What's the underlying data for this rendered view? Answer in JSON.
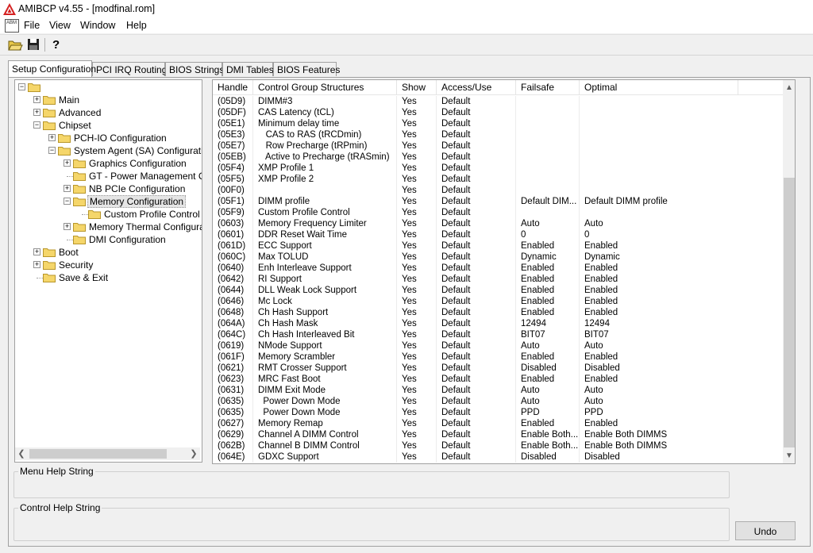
{
  "window": {
    "title": "AMIBCP v4.55 - [modfinal.rom]"
  },
  "menubar": {
    "app_icon_text": "ABM",
    "items": [
      "File",
      "View",
      "Window",
      "Help"
    ]
  },
  "toolbar": {
    "buttons": [
      "open-folder-icon",
      "save-icon",
      "help-icon"
    ]
  },
  "tabs": [
    "Setup Configuration",
    "PCI IRQ Routing",
    "BIOS Strings",
    "DMI Tables",
    "BIOS Features"
  ],
  "tree": {
    "items": [
      {
        "label": "",
        "level": 0,
        "expander": "minus"
      },
      {
        "label": "Main",
        "level": 1,
        "expander": "plus"
      },
      {
        "label": "Advanced",
        "level": 1,
        "expander": "plus"
      },
      {
        "label": "Chipset",
        "level": 1,
        "expander": "minus"
      },
      {
        "label": "PCH-IO Configuration",
        "level": 2,
        "expander": "plus"
      },
      {
        "label": "System Agent (SA) Configuration",
        "level": 2,
        "expander": "minus"
      },
      {
        "label": "Graphics Configuration",
        "level": 3,
        "expander": "plus"
      },
      {
        "label": "GT - Power Management Control",
        "level": 3,
        "expander": "none"
      },
      {
        "label": "NB PCIe Configuration",
        "level": 3,
        "expander": "plus"
      },
      {
        "label": "Memory Configuration",
        "level": 3,
        "expander": "minus",
        "selected": true
      },
      {
        "label": "Custom Profile Control",
        "level": 4,
        "expander": "none"
      },
      {
        "label": "Memory Thermal Configuration",
        "level": 3,
        "expander": "plus"
      },
      {
        "label": "DMI Configuration",
        "level": 3,
        "expander": "none"
      },
      {
        "label": "Boot",
        "level": 1,
        "expander": "plus"
      },
      {
        "label": "Security",
        "level": 1,
        "expander": "plus"
      },
      {
        "label": "Save & Exit",
        "level": 1,
        "expander": "none"
      }
    ]
  },
  "grid": {
    "columns": [
      "Handle",
      "Control Group Structures",
      "Show",
      "Access/Use",
      "Failsafe",
      "Optimal"
    ],
    "rows": [
      [
        "(05D9)",
        "DIMM#3",
        "Yes",
        "Default",
        "",
        ""
      ],
      [
        "(05DF)",
        "CAS Latency (tCL)",
        "Yes",
        "Default",
        "",
        ""
      ],
      [
        "(05E1)",
        "Minimum delay time",
        "Yes",
        "Default",
        "",
        ""
      ],
      [
        "(05E3)",
        "   CAS to RAS (tRCDmin)",
        "Yes",
        "Default",
        "",
        ""
      ],
      [
        "(05E7)",
        "   Row Precharge (tRPmin)",
        "Yes",
        "Default",
        "",
        ""
      ],
      [
        "(05EB)",
        "   Active to Precharge (tRASmin)",
        "Yes",
        "Default",
        "",
        ""
      ],
      [
        "(05F4)",
        "XMP Profile 1",
        "Yes",
        "Default",
        "",
        ""
      ],
      [
        "(05F5)",
        "XMP Profile 2",
        "Yes",
        "Default",
        "",
        ""
      ],
      [
        "(00F0)",
        "",
        "Yes",
        "Default",
        "",
        ""
      ],
      [
        "(05F1)",
        "DIMM profile",
        "Yes",
        "Default",
        "Default DIM...",
        "Default DIMM profile"
      ],
      [
        "(05F9)",
        "Custom Profile Control",
        "Yes",
        "Default",
        "",
        ""
      ],
      [
        "(0603)",
        "Memory Frequency Limiter",
        "Yes",
        "Default",
        "Auto",
        "Auto"
      ],
      [
        "(0601)",
        "DDR Reset Wait Time",
        "Yes",
        "Default",
        "0",
        "0"
      ],
      [
        "(061D)",
        "ECC Support",
        "Yes",
        "Default",
        "Enabled",
        "Enabled"
      ],
      [
        "(060C)",
        "Max TOLUD",
        "Yes",
        "Default",
        "Dynamic",
        "Dynamic"
      ],
      [
        "(0640)",
        "Enh Interleave Support",
        "Yes",
        "Default",
        "Enabled",
        "Enabled"
      ],
      [
        "(0642)",
        "RI Support",
        "Yes",
        "Default",
        "Enabled",
        "Enabled"
      ],
      [
        "(0644)",
        "DLL Weak Lock Support",
        "Yes",
        "Default",
        "Enabled",
        "Enabled"
      ],
      [
        "(0646)",
        "Mc Lock",
        "Yes",
        "Default",
        "Enabled",
        "Enabled"
      ],
      [
        "(0648)",
        "Ch Hash Support",
        "Yes",
        "Default",
        "Enabled",
        "Enabled"
      ],
      [
        "(064A)",
        "Ch Hash Mask",
        "Yes",
        "Default",
        "12494",
        "12494"
      ],
      [
        "(064C)",
        "Ch Hash Interleaved Bit",
        "Yes",
        "Default",
        "BIT07",
        "BIT07"
      ],
      [
        "(0619)",
        "NMode Support",
        "Yes",
        "Default",
        "Auto",
        "Auto"
      ],
      [
        "(061F)",
        "Memory Scrambler",
        "Yes",
        "Default",
        "Enabled",
        "Enabled"
      ],
      [
        "(0621)",
        "RMT Crosser Support",
        "Yes",
        "Default",
        "Disabled",
        "Disabled"
      ],
      [
        "(0623)",
        "MRC Fast Boot",
        "Yes",
        "Default",
        "Enabled",
        "Enabled"
      ],
      [
        "(0631)",
        "DIMM Exit Mode",
        "Yes",
        "Default",
        "Auto",
        "Auto"
      ],
      [
        "(0635)",
        "  Power Down Mode",
        "Yes",
        "Default",
        "Auto",
        "Auto"
      ],
      [
        "(0635)",
        "  Power Down Mode",
        "Yes",
        "Default",
        "PPD",
        "PPD"
      ],
      [
        "(0627)",
        "Memory Remap",
        "Yes",
        "Default",
        "Enabled",
        "Enabled"
      ],
      [
        "(0629)",
        "Channel A DIMM Control",
        "Yes",
        "Default",
        "Enable Both...",
        "Enable Both DIMMS"
      ],
      [
        "(062B)",
        "Channel B DIMM Control",
        "Yes",
        "Default",
        "Enable Both...",
        "Enable Both DIMMS"
      ],
      [
        "(064E)",
        "GDXC Support",
        "Yes",
        "Default",
        "Disabled",
        "Disabled"
      ]
    ]
  },
  "help": {
    "menu_label": "Menu Help String",
    "control_label": "Control Help String"
  },
  "buttons": {
    "undo": "Undo"
  }
}
